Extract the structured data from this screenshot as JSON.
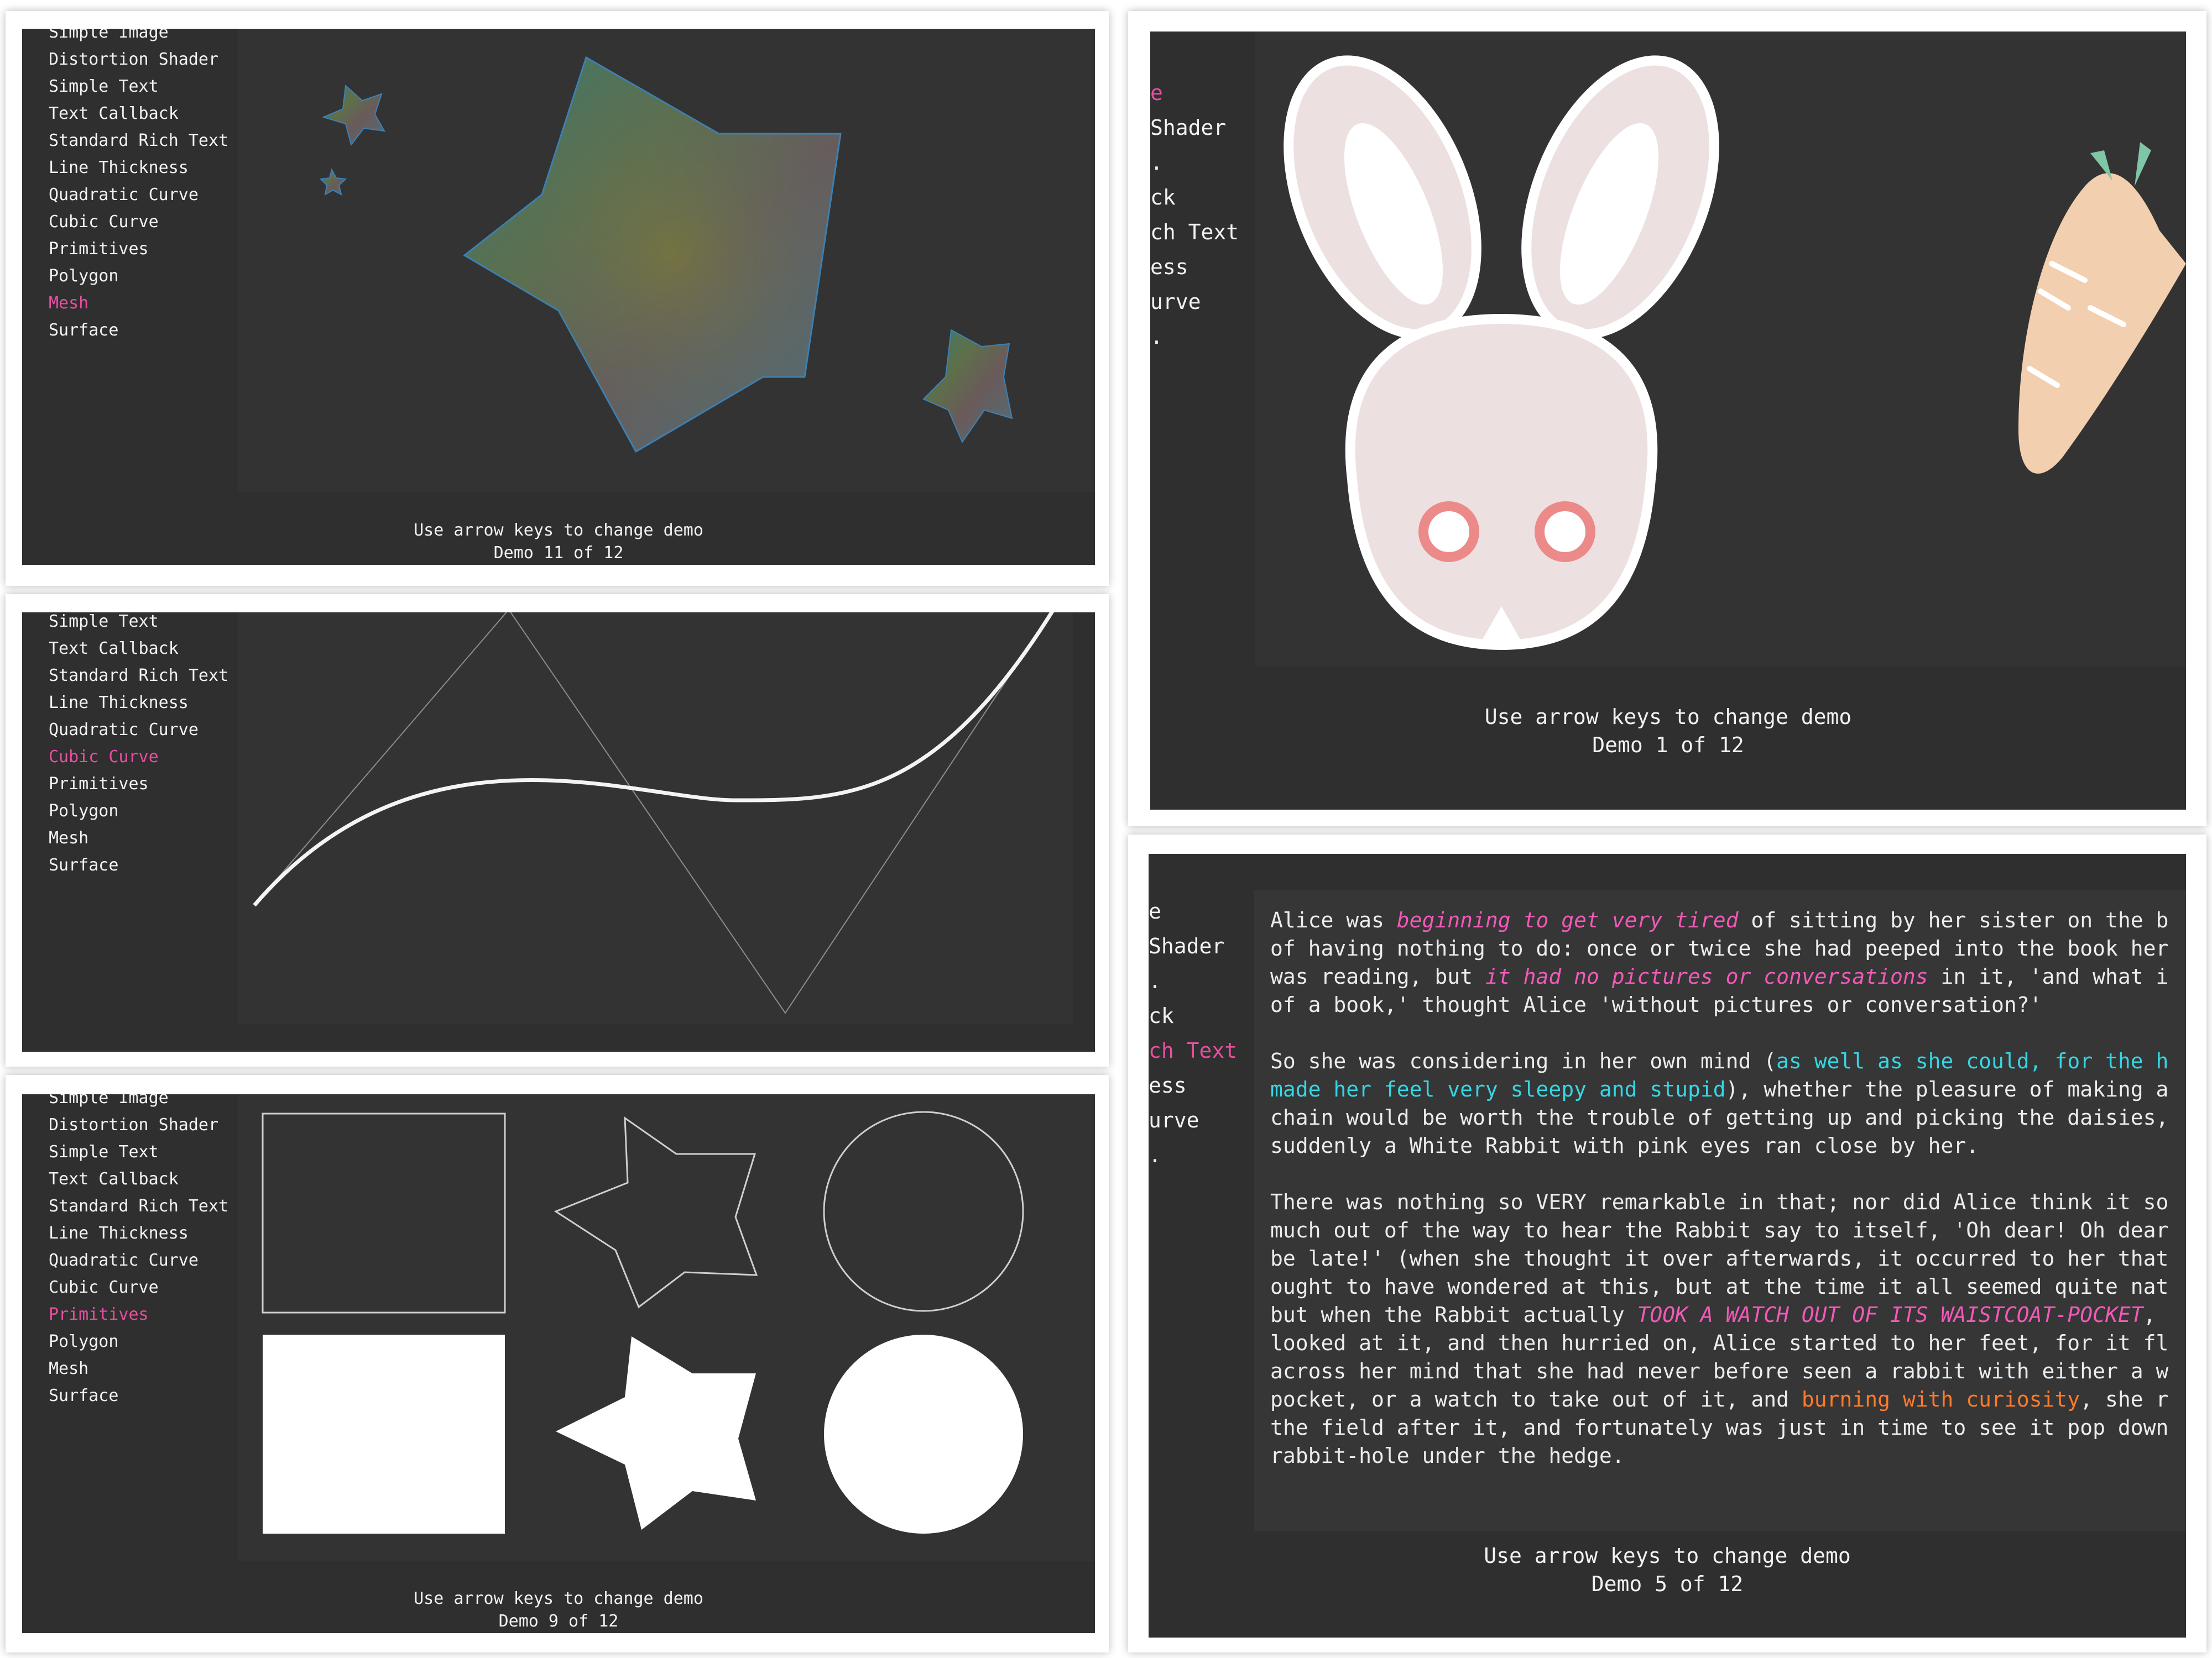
{
  "footer": {
    "hint": "Use arrow keys to change demo"
  },
  "panels": {
    "mesh": {
      "menu": [
        "Simple Image",
        "Distortion Shader",
        "Simple Text",
        "Text Callback",
        "Standard Rich Text",
        "Line Thickness",
        "Quadratic Curve",
        "Cubic Curve",
        "Primitives",
        "Polygon",
        "Mesh",
        "Surface"
      ],
      "active": "Mesh",
      "demo": "Demo 11 of 12"
    },
    "cubic": {
      "menu": [
        "Simple Text",
        "Text Callback",
        "Standard Rich Text",
        "Line Thickness",
        "Quadratic Curve",
        "Cubic Curve",
        "Primitives",
        "Polygon",
        "Mesh",
        "Surface"
      ],
      "active": "Cubic Curve"
    },
    "primitives": {
      "menu": [
        "Simple Image",
        "Distortion Shader",
        "Simple Text",
        "Text Callback",
        "Standard Rich Text",
        "Line Thickness",
        "Quadratic Curve",
        "Cubic Curve",
        "Primitives",
        "Polygon",
        "Mesh",
        "Surface"
      ],
      "active": "Primitives",
      "demo": "Demo 9 of 12"
    },
    "bunny": {
      "menu": [
        "e",
        "Shader",
        ".",
        "ck",
        "ch Text",
        "ess",
        "urve",
        "."
      ],
      "active": "e",
      "demo": "Demo 1 of 12"
    },
    "rich": {
      "menu": [
        "e",
        "Shader",
        ".",
        "ck",
        "ch Text",
        "ess",
        "urve",
        "."
      ],
      "active": "ch Text",
      "demo": "Demo 5 of 12"
    }
  },
  "rich_text": {
    "p1": {
      "a": "Alice was ",
      "b": "beginning to get very tired",
      "c": " of sitting by her sister on the b",
      "l2": "of having nothing to do: once or twice she had peeped into the book her",
      "l3a": "was reading, but ",
      "l3b": "it had no pictures or conversations",
      "l3c": " in it, 'and what i",
      "l4": "of a book,' thought Alice 'without pictures or conversation?'"
    },
    "p2": {
      "l1a": "So she was considering in her own mind (",
      "l1b": "as well as she could, for the h",
      "l2a": "made her feel very sleepy and stupid",
      "l2b": "), whether the pleasure of making a",
      "l3": "chain would be worth the trouble of getting up and picking the daisies,",
      "l4": "suddenly a White Rabbit with pink eyes ran close by her."
    },
    "p3": {
      "l1": "There was nothing so VERY remarkable in that; nor did Alice think it so",
      "l2": "much out of the way to hear the Rabbit say to itself, 'Oh dear! Oh dear",
      "l3": "be late!' (when she thought it over afterwards, it occurred to her that",
      "l4": "ought to have wondered at this, but at the time it all seemed quite nat",
      "l5a": "but when the Rabbit actually ",
      "l5b": "TOOK A WATCH OUT OF ITS WAISTCOAT-POCKET",
      "l5c": ",",
      "l6": "looked at it, and then hurried on, Alice started to her feet, for it fl",
      "l7": "across her mind that she had never before seen a rabbit with either a w",
      "l8a": "pocket, or a watch to take out of it, and ",
      "l8b": "burning with curiosity",
      "l8c": ", she r",
      "l9": "the field after it, and fortunately was just in time to see it pop down",
      "l10": "rabbit-hole under the hedge."
    }
  },
  "colors": {
    "screen_bg": "#2f2f2f",
    "active_menu": "#e84f9f",
    "rich_pink": "#f05ab8",
    "rich_cyan": "#34d7e5",
    "rich_orange": "#ff7a2a"
  }
}
